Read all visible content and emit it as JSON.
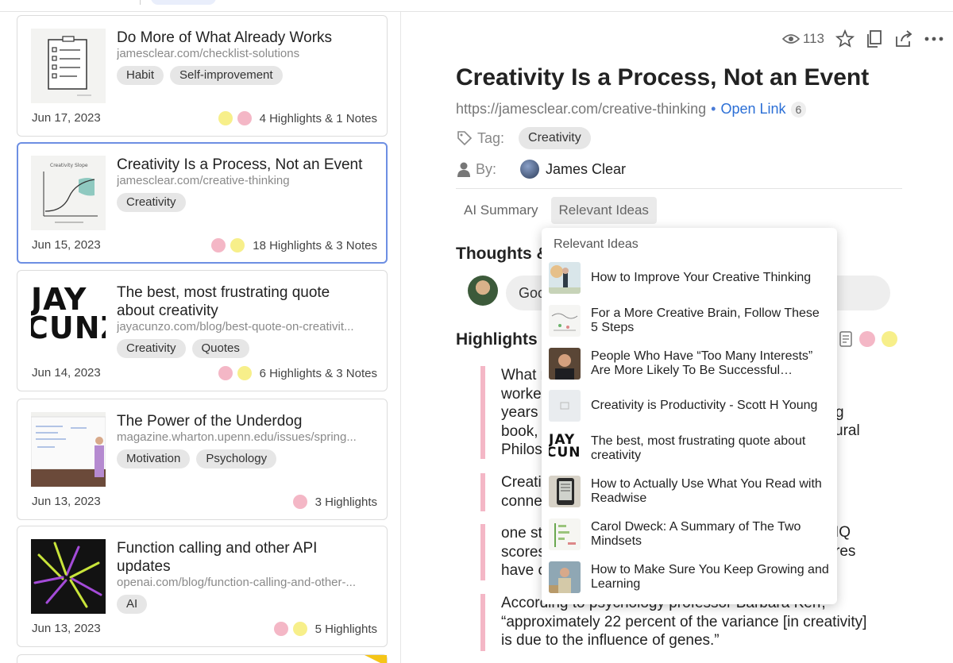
{
  "articles": [
    {
      "title": "Do More of What Already Works",
      "url": "jamesclear.com/checklist-solutions",
      "tags": [
        "Habit",
        "Self-improvement"
      ],
      "date": "Jun 17, 2023",
      "highlights": "4 Highlights & 1 Notes",
      "thumb_icon": "checklist-sketch-icon",
      "dot_colors": [
        "#f7ef8a",
        "#f4b7c6"
      ]
    },
    {
      "title": "Creativity Is a Process, Not an Event",
      "url": "jamesclear.com/creative-thinking",
      "tags": [
        "Creativity"
      ],
      "date": "Jun 15, 2023",
      "highlights": "18 Highlights & 3 Notes",
      "thumb_icon": "curve-graph-icon",
      "dot_colors": [
        "#f4b7c6",
        "#f7ef8a"
      ]
    },
    {
      "title": "The best, most frustrating quote about creativity",
      "url": "jayacunzo.com/blog/best-quote-on-creativit...",
      "tags": [
        "Creativity",
        "Quotes"
      ],
      "date": "Jun 14, 2023",
      "highlights": "6 Highlights & 3 Notes",
      "thumb_text_1": "JAY",
      "thumb_text_2": "CUNZ",
      "dot_colors": [
        "#f4b7c6",
        "#f7ef8a"
      ]
    },
    {
      "title": "The Power of the Underdog",
      "url": "magazine.wharton.upenn.edu/issues/spring...",
      "tags": [
        "Motivation",
        "Psychology"
      ],
      "date": "Jun 13, 2023",
      "highlights": "3 Highlights",
      "thumb_icon": "whiteboard-speaker-icon",
      "dot_colors": [
        "#f4b7c6"
      ]
    },
    {
      "title": "Function calling and other API updates",
      "url": "openai.com/blog/function-calling-and-other-...",
      "tags": [
        "AI"
      ],
      "date": "Jun 13, 2023",
      "highlights": "5 Highlights",
      "thumb_icon": "neon-lines-icon",
      "dot_colors": [
        "#f4b7c6",
        "#f7ef8a"
      ]
    }
  ],
  "detail": {
    "views": "113",
    "title": "Creativity Is a Process, Not an Event",
    "url": "https://jamesclear.com/creative-thinking",
    "separator": "•",
    "open_link": "Open Link",
    "link_count": "6",
    "tag_label": "Tag:",
    "tag": "Creativity",
    "by_label": "By:",
    "author": "James Clear",
    "tabs": [
      "AI Summary",
      "Relevant Ideas"
    ],
    "thoughts_title": "Thoughts &",
    "comment_placeholder": "Goo",
    "highlights_title": "Highlights &",
    "quotes": [
      [
        "What r",
        "worke",
        "years",
        "book, T",
        "Philos"
      ],
      [
        "Creati",
        "conne"
      ],
      [
        "one st",
        "scores",
        "have c"
      ],
      [
        "According to psychology professor Barbara Kerr,",
        "“approximately 22 percent of the variance [in creativity]",
        "is due to the influence of genes.”"
      ]
    ],
    "quote_right_fragments": [
      {
        "row": 3,
        "text": "g"
      },
      {
        "row": 4,
        "text": "ural"
      },
      {
        "row": 6,
        "text": "IQ"
      },
      {
        "row": 7,
        "text": "res"
      }
    ]
  },
  "dropdown": {
    "heading": "Relevant Ideas",
    "items": [
      {
        "title": "How to Improve Your Creative Thinking",
        "thumb": "illustration-figure-icon"
      },
      {
        "title": "For a More Creative Brain, Follow These 5 Steps",
        "thumb": "doodle-diagram-icon"
      },
      {
        "title": "People Who Have “Too Many Interests” Are More Likely To Be Successful…",
        "thumb": "portrait-photo-icon"
      },
      {
        "title": "Creativity is Productivity - Scott H Young",
        "thumb": "image-placeholder-icon"
      },
      {
        "title": "The best, most frustrating quote about creativity",
        "thumb": "jay-cunzo-logo-icon"
      },
      {
        "title": "How to Actually Use What You Read with Readwise",
        "thumb": "ereader-icon"
      },
      {
        "title": "Carol Dweck: A Summary of The Two Mindsets",
        "thumb": "mindset-chart-icon"
      },
      {
        "title": "How to Make Sure You Keep Growing and Learning",
        "thumb": "speaker-photo-icon"
      }
    ]
  },
  "colors": {
    "accent": "#2b6fd6",
    "selected_border": "#6d8fe3",
    "highlight_pink": "#f4b7c6",
    "highlight_yellow": "#f7ef8a"
  }
}
